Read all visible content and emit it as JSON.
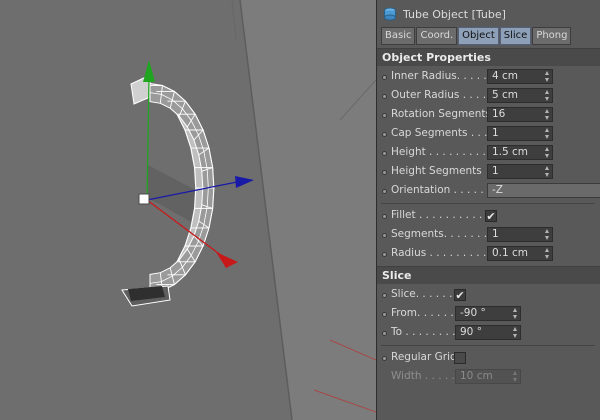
{
  "panel": {
    "title": "Tube Object [Tube]",
    "tabs": [
      {
        "label": "Basic",
        "active": false
      },
      {
        "label": "Coord.",
        "active": false
      },
      {
        "label": "Object",
        "active": true
      },
      {
        "label": "Slice",
        "active": true
      },
      {
        "label": "Phong",
        "active": false
      }
    ],
    "object_properties": {
      "heading": "Object Properties",
      "inner_radius": {
        "label": "Inner Radius. . . . .",
        "value": "4 cm"
      },
      "outer_radius": {
        "label": "Outer Radius . . . .",
        "value": "5 cm"
      },
      "rotation_segments": {
        "label": "Rotation Segments",
        "value": "16"
      },
      "cap_segments": {
        "label": "Cap Segments . . .",
        "value": "1"
      },
      "height": {
        "label": "Height . . . . . . . . .",
        "value": "1.5 cm"
      },
      "height_segments": {
        "label": "Height Segments",
        "value": "1"
      },
      "orientation": {
        "label": "Orientation . . . . . .",
        "value": "-Z"
      },
      "fillet": {
        "label": "Fillet . . . . . . . . . . .",
        "checked": true
      },
      "segments": {
        "label": "Segments. . . . . . .",
        "value": "1"
      },
      "radius": {
        "label": "Radius . . . . . . . . .",
        "value": "0.1 cm"
      }
    },
    "slice": {
      "heading": "Slice",
      "slice_toggle": {
        "label": "Slice. . . . . .",
        "checked": true
      },
      "from": {
        "label": "From. . . . . .",
        "value": "-90 °"
      },
      "to": {
        "label": "To . . . . . . . .",
        "value": "90 °"
      },
      "regular_grid": {
        "label": "Regular Grid",
        "checked": false
      },
      "width": {
        "label": "Width . . . . .",
        "value": "10 cm"
      }
    }
  },
  "colors": {
    "x_axis": "#c8191a",
    "y_axis": "#1fa51f",
    "z_axis": "#1a1aa8",
    "active_tab": "#8ea0b8"
  }
}
